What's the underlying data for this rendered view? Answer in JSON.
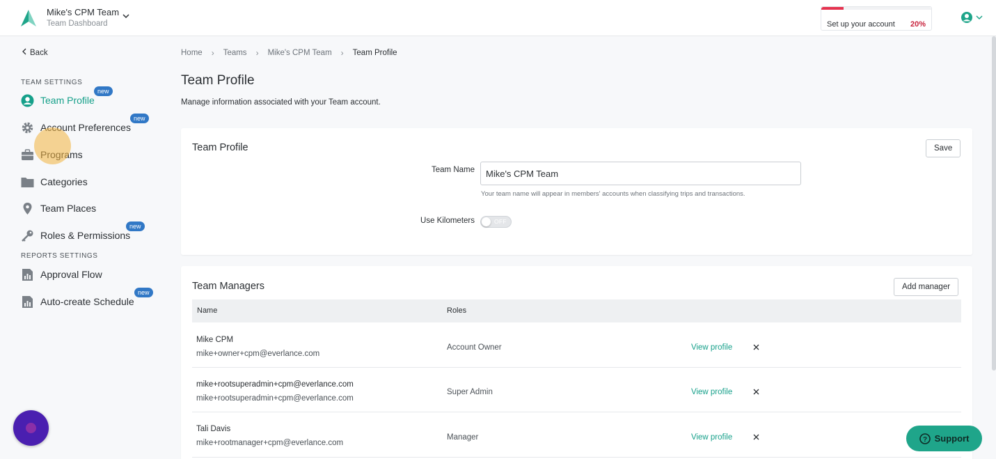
{
  "header": {
    "team_name": "Mike's CPM Team",
    "team_subtitle": "Team Dashboard",
    "setup_label": "Set up your account",
    "setup_percent_text": "20%",
    "setup_progress": 0.2,
    "accent_color": "#16a08a",
    "progress_color": "#e5334f"
  },
  "sidebar": {
    "back_label": "Back",
    "team_settings_label": "TEAM SETTINGS",
    "reports_settings_label": "REPORTS SETTINGS",
    "badge_text": "new",
    "items": [
      {
        "label": "Team Profile",
        "icon": "user-circle-icon",
        "badge": true,
        "active": true
      },
      {
        "label": "Account Preferences",
        "icon": "gear-icon",
        "badge": true
      },
      {
        "label": "Programs",
        "icon": "briefcase-icon",
        "badge": false
      },
      {
        "label": "Categories",
        "icon": "folder-icon",
        "badge": false
      },
      {
        "label": "Team Places",
        "icon": "map-pin-icon",
        "badge": false
      },
      {
        "label": "Roles & Permissions",
        "icon": "key-icon",
        "badge": true
      }
    ],
    "report_items": [
      {
        "label": "Approval Flow",
        "icon": "report-icon",
        "badge": false
      },
      {
        "label": "Auto-create Schedule",
        "icon": "report-icon",
        "badge": true
      }
    ]
  },
  "breadcrumb": [
    "Home",
    "Teams",
    "Mike's CPM Team",
    "Team Profile"
  ],
  "page": {
    "title": "Team Profile",
    "description": "Manage information associated with your Team account."
  },
  "profile_card": {
    "title": "Team Profile",
    "save_label": "Save",
    "team_name_label": "Team Name",
    "team_name_value": "Mike's CPM Team",
    "team_name_help": "Your team name will appear in members' accounts when classifying trips and transactions.",
    "kilometers_label": "Use Kilometers",
    "kilometers_toggle_text": "OFF"
  },
  "managers_card": {
    "title": "Team Managers",
    "add_label": "Add manager",
    "columns": [
      "Name",
      "Roles"
    ],
    "view_label": "View profile",
    "rows": [
      {
        "name": "Mike CPM",
        "email": "mike+owner+cpm@everlance.com",
        "role": "Account Owner"
      },
      {
        "name": "mike+rootsuperadmin+cpm@everlance.com",
        "email": "mike+rootsuperadmin+cpm@everlance.com",
        "role": "Super Admin"
      },
      {
        "name": "Tali Davis",
        "email": "mike+rootmanager+cpm@everlance.com",
        "role": "Manager"
      }
    ]
  },
  "support": {
    "label": "Support"
  }
}
